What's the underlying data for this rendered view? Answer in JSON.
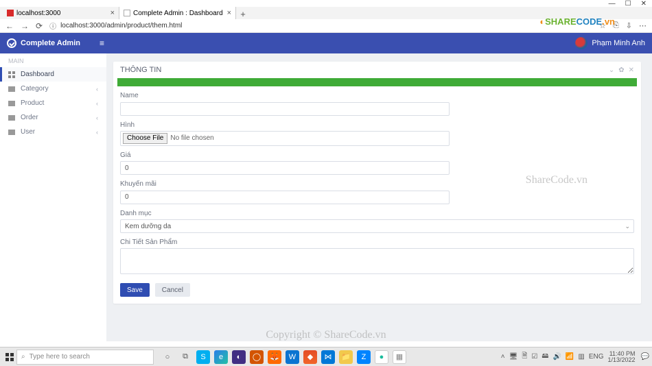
{
  "window": {
    "controls": {
      "min": "—",
      "max": "☐",
      "close": "✕"
    }
  },
  "browser": {
    "tabs": [
      {
        "title": "localhost:3000",
        "active": false
      },
      {
        "title": "Complete Admin : Dashboard",
        "active": true
      }
    ],
    "add_tab": "+",
    "nav": {
      "back": "←",
      "forward": "→",
      "reload": "⟳"
    },
    "url_icon": "ⓘ",
    "url": "localhost:3000/admin/product/them.html",
    "toolbar_icons": [
      "☆",
      "⎘",
      "⇩",
      "⋯"
    ]
  },
  "logo_brand": {
    "text": "SHARECODE",
    "suffix": ".vn"
  },
  "header": {
    "brand": "Complete Admin",
    "menu_icon": "≡",
    "user_name": "Phạm Minh Anh"
  },
  "sidebar": {
    "heading": "MAIN",
    "items": [
      {
        "label": "Dashboard",
        "expandable": false
      },
      {
        "label": "Category",
        "expandable": true
      },
      {
        "label": "Product",
        "expandable": true
      },
      {
        "label": "Order",
        "expandable": true
      },
      {
        "label": "User",
        "expandable": true
      }
    ]
  },
  "card": {
    "title": "THÔNG TIN",
    "tools": {
      "collapse": "⌄",
      "settings": "✿",
      "close": "✕"
    }
  },
  "form": {
    "name": {
      "label": "Name",
      "value": ""
    },
    "image": {
      "label": "Hình",
      "button": "Choose File",
      "status": "No file chosen"
    },
    "price": {
      "label": "Giá",
      "value": "0"
    },
    "promo": {
      "label": "Khuyến mãi",
      "value": "0"
    },
    "category": {
      "label": "Danh mục",
      "selected": "Kem dưỡng da"
    },
    "detail": {
      "label": "Chi Tiết Sản Phẩm",
      "value": ""
    },
    "save": "Save",
    "cancel": "Cancel"
  },
  "watermarks": {
    "center": "Copyright © ShareCode.vn",
    "right": "ShareCode.vn"
  },
  "taskbar": {
    "search_placeholder": "Type here to search",
    "lang": "ENG",
    "time": "11:40 PM",
    "date": "1/13/2022"
  }
}
